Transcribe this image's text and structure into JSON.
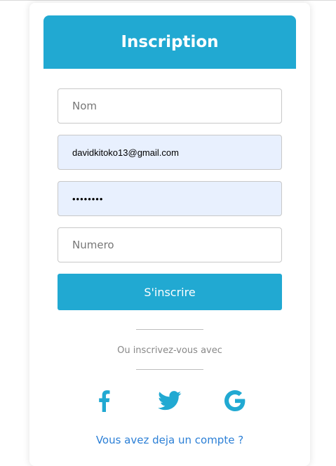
{
  "form": {
    "title": "Inscription",
    "fields": {
      "name_placeholder": "Nom",
      "email_value": "davidkitoko13@gmail.com",
      "password_value": "••••••••",
      "phone_placeholder": "Numero"
    },
    "submit_label": "S'inscrire",
    "alt_text": "Ou inscrivez-vous avec",
    "social": [
      "facebook-icon",
      "twitter-icon",
      "google-icon"
    ],
    "login_link": "Vous avez deja un compte ?"
  },
  "colors": {
    "accent": "#21a9d2",
    "autofill_bg": "#e8f0fe",
    "link": "#2b7fd6"
  }
}
